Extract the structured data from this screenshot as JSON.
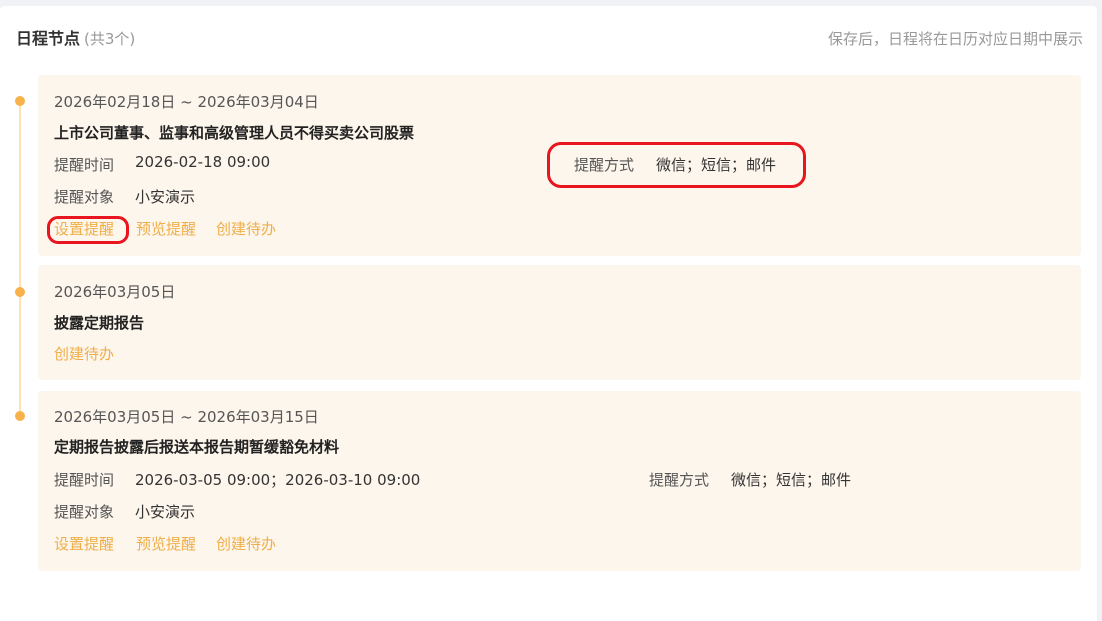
{
  "header": {
    "title": "日程节点",
    "count": "(共3个)",
    "hint": "保存后，日程将在日历对应日期中展示"
  },
  "nodes": [
    {
      "date": "2026年02月18日 ~ 2026年03月04日",
      "name": "上市公司董事、监事和高级管理人员不得买卖公司股票",
      "remind_time_label": "提醒时间",
      "remind_time": "2026-02-18 09:00",
      "remind_method_label": "提醒方式",
      "remind_method": "微信；短信；邮件",
      "remind_target_label": "提醒对象",
      "remind_target": "小安演示",
      "actions": [
        "设置提醒",
        "预览提醒",
        "创建待办"
      ]
    },
    {
      "date": "2026年03月05日",
      "name": "披露定期报告",
      "actions": [
        "创建待办"
      ]
    },
    {
      "date": "2026年03月05日 ~ 2026年03月15日",
      "name": "定期报告披露后报送本报告期暂缓豁免材料",
      "remind_time_label": "提醒时间",
      "remind_time": "2026-03-05 09:00；2026-03-10 09:00",
      "remind_method_label": "提醒方式",
      "remind_method": "微信；短信；邮件",
      "remind_target_label": "提醒对象",
      "remind_target": "小安演示",
      "actions": [
        "设置提醒",
        "预览提醒",
        "创建待办"
      ]
    }
  ],
  "colors": {
    "accent": "#f0ae4a",
    "card_bg": "#fdf6ec",
    "timeline": "#ffe2b0",
    "dot": "#f7b24b",
    "annotation": "#e8141e"
  }
}
